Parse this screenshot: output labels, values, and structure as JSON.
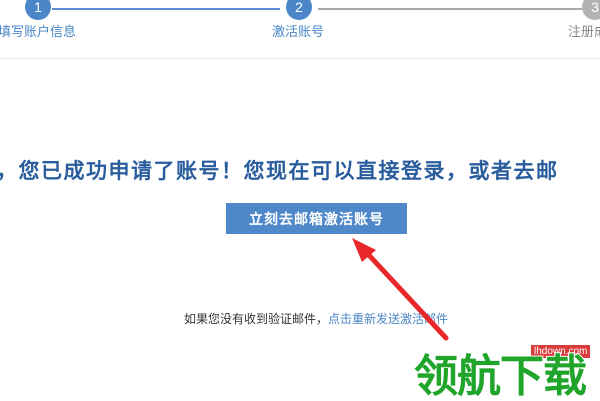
{
  "colors": {
    "accent": "#4a86c8",
    "button": "#4f88c9",
    "step_line_done": "#5b8fcf",
    "step_line_todo": "#aaaaaa",
    "step_inactive": "#b3b3b3",
    "message_text": "#2a5d9d",
    "arrow_red": "#e8282b",
    "watermark_green": "#1fa52a",
    "watermark_badge": "#d93a3a"
  },
  "stepper": {
    "steps": [
      {
        "number": "1",
        "label": "填写账户信息",
        "state": "done"
      },
      {
        "number": "2",
        "label": "激活账号",
        "state": "current"
      },
      {
        "number": "3",
        "label": "注册成",
        "state": "todo"
      }
    ]
  },
  "main": {
    "message": "，您已成功申请了账号！您现在可以直接登录，或者去邮",
    "activate_button": "立刻去邮箱激活账号",
    "resend_prefix": "如果您没有收到验证邮件，",
    "resend_link": "点击重新发送激活邮件"
  },
  "watermark": {
    "url": "lhdown.com",
    "logo_text": "领航下载"
  }
}
